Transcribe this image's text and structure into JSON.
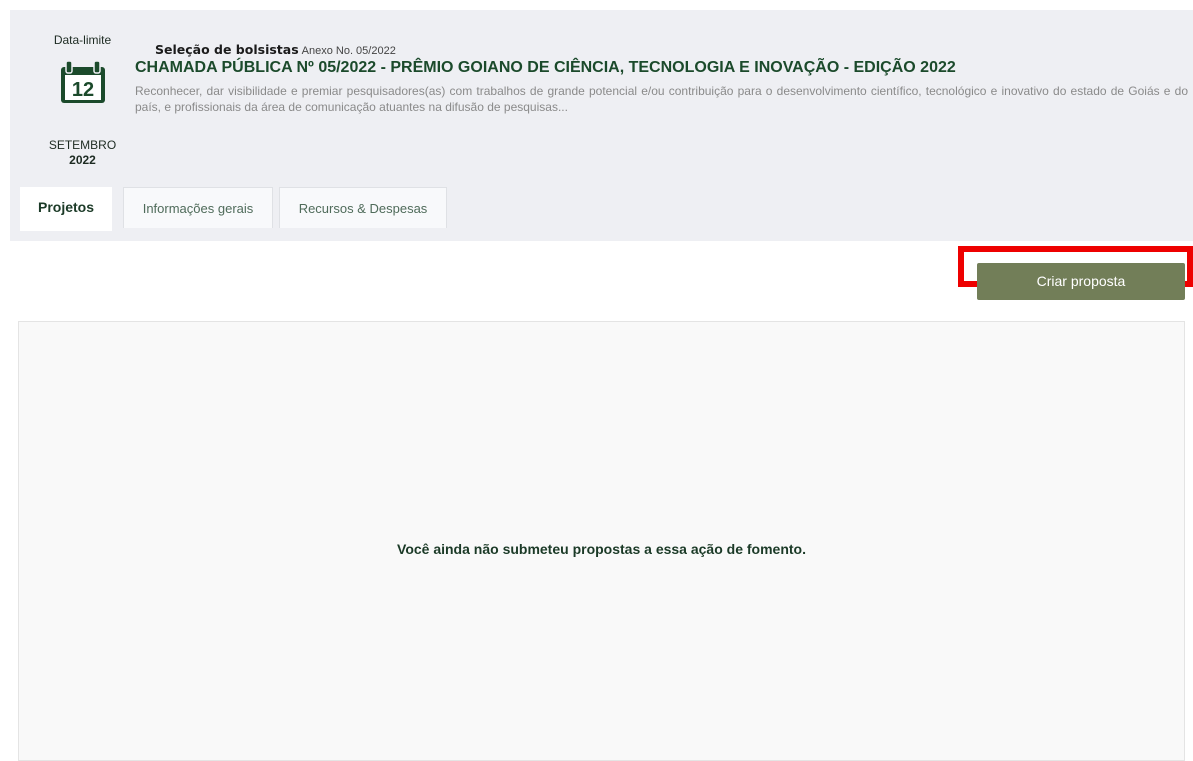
{
  "header": {
    "deadline_label": "Data-limite",
    "day": "12",
    "month": "SETEMBRO",
    "year": "2022",
    "category": "Seleção de bolsistas",
    "annex": "Anexo No. 05/2022",
    "title": "CHAMADA PÚBLICA Nº 05/2022 - PRÊMIO GOIANO DE CIÊNCIA, TECNOLOGIA E INOVAÇÃO - EDIÇÃO 2022",
    "description": "Reconhecer, dar visibilidade e premiar pesquisadores(as) com trabalhos de grande potencial e/ou contribuição para o desenvolvimento científico, tecnológico e inovativo do estado de Goiás e do país, e profissionais da área de comunicação atuantes na difusão de pesquisas..."
  },
  "tabs": [
    {
      "label": "Projetos",
      "active": true
    },
    {
      "label": "Informações gerais",
      "active": false
    },
    {
      "label": "Recursos & Despesas",
      "active": false
    }
  ],
  "actions": {
    "create_label": "Criar proposta"
  },
  "main": {
    "empty_message": "Você ainda não submeteu propostas a essa ação de fomento."
  },
  "colors": {
    "brand_green": "#1b4a2b",
    "button_olive": "#727e58",
    "highlight_red": "#ee0000",
    "header_bg": "#eeeff3"
  },
  "icons": {
    "calendar": "calendar-icon"
  }
}
